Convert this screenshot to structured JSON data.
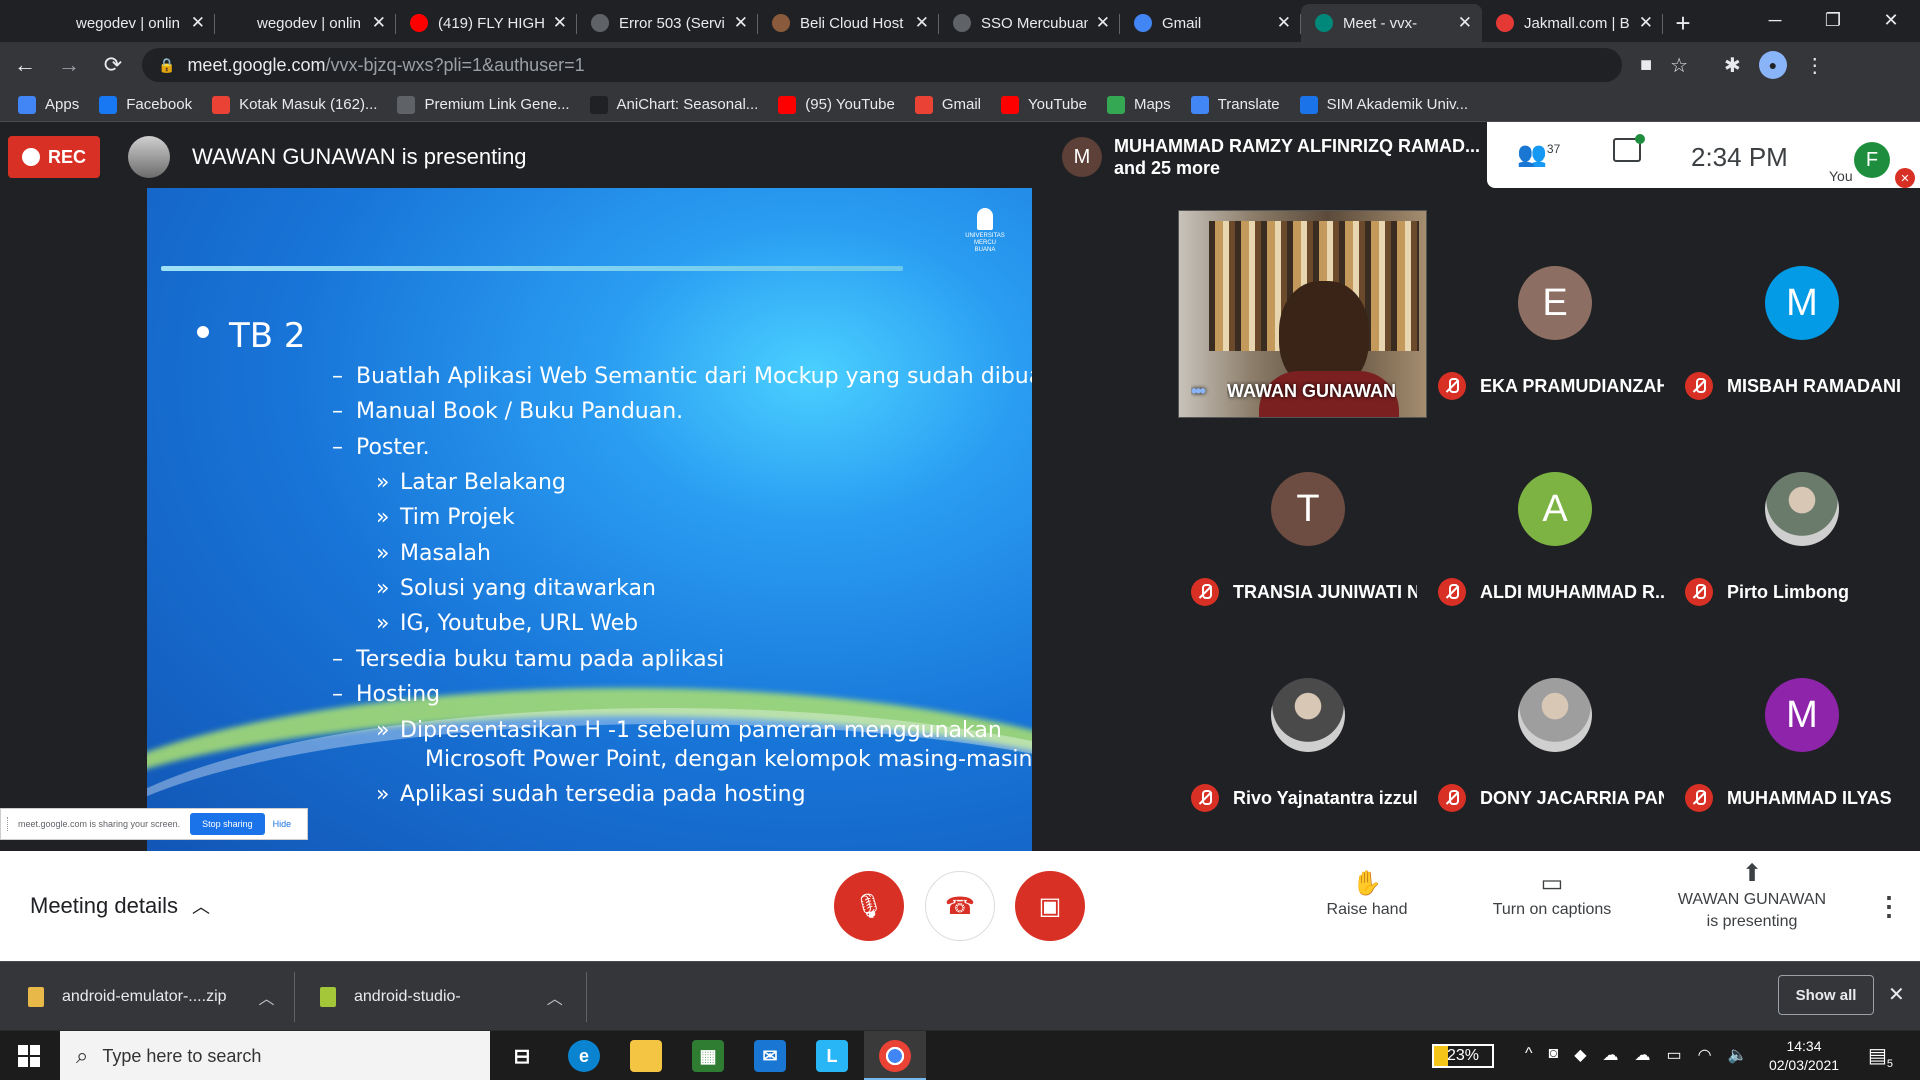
{
  "browser": {
    "tabs": [
      {
        "title": "wegodev | onlin",
        "color": "#202124",
        "icon": "wegodev-icon"
      },
      {
        "title": "wegodev | onlin",
        "color": "#202124",
        "icon": "wegodev-icon"
      },
      {
        "title": "(419) FLY HIGH",
        "color": "#ff0000",
        "icon": "youtube-icon"
      },
      {
        "title": "Error 503 (Servi",
        "color": "#5f6368",
        "icon": "globe-icon"
      },
      {
        "title": "Beli Cloud Host",
        "color": "#8a5a3c",
        "icon": "cloud-host-icon"
      },
      {
        "title": "SSO Mercubuan",
        "color": "#5f6368",
        "icon": "globe-icon"
      },
      {
        "title": "Gmail",
        "color": "#4285f4",
        "icon": "google-icon"
      },
      {
        "title": "Meet - vvx-",
        "color": "#00897b",
        "icon": "meet-icon",
        "active": true
      },
      {
        "title": "Jakmall.com | B",
        "color": "#e53935",
        "icon": "jakmall-icon"
      }
    ],
    "new_tab": "+",
    "url_host": "meet.google.com",
    "url_path": "/vvx-bjzq-wxs?pli=1&authuser=1",
    "bookmarks": [
      {
        "label": "Apps",
        "color": "#4285f4"
      },
      {
        "label": "Facebook",
        "color": "#1877f2"
      },
      {
        "label": "Kotak Masuk (162)...",
        "color": "#ea4335"
      },
      {
        "label": "Premium Link Gene...",
        "color": "#5f6368"
      },
      {
        "label": "AniChart: Seasonal...",
        "color": "#202124"
      },
      {
        "label": "(95) YouTube",
        "color": "#ff0000"
      },
      {
        "label": "Gmail",
        "color": "#ea4335"
      },
      {
        "label": "YouTube",
        "color": "#ff0000"
      },
      {
        "label": "Maps",
        "color": "#34a853"
      },
      {
        "label": "Translate",
        "color": "#4285f4"
      },
      {
        "label": "SIM Akademik Univ...",
        "color": "#1a73e8"
      }
    ]
  },
  "meet": {
    "rec_label": "REC",
    "presenter_title": "WAWAN GUNAWAN is presenting",
    "speaker_initial": "M",
    "speaker_name": "MUHAMMAD RAMZY ALFINRIZQ RAMAD...",
    "speaker_more": "and 25 more",
    "people_count": "37",
    "time": "2:34 PM",
    "you_label": "You",
    "you_initial": "F"
  },
  "slide": {
    "logo_text": "UNIVERSITAS MERCU BUANA",
    "heading": "TB 2",
    "lines": [
      {
        "text": "Buatlah Aplikasi Web Semantic dari Mockup yang sudah dibuat",
        "marker": "–"
      },
      {
        "text": "Manual Book / Buku Panduan.",
        "marker": "–"
      },
      {
        "text": "Poster.",
        "marker": "–"
      },
      {
        "text": "Latar Belakang",
        "marker": "»"
      },
      {
        "text": "Tim Projek",
        "marker": "»"
      },
      {
        "text": "Masalah",
        "marker": "»"
      },
      {
        "text": "Solusi yang ditawarkan",
        "marker": "»"
      },
      {
        "text": "IG, Youtube, URL Web",
        "marker": "»"
      },
      {
        "text": "Tersedia buku tamu pada aplikasi",
        "marker": "–"
      },
      {
        "text": "Hosting",
        "marker": "–"
      },
      {
        "text": "Dipresentasikan H -1 sebelum pameran menggunakan",
        "marker": "»"
      },
      {
        "text": "Microsoft Power Point, dengan kelompok masing-masing.",
        "marker": ""
      },
      {
        "text": "Aplikasi sudah tersedia pada hosting",
        "marker": "»"
      }
    ]
  },
  "sharebar": {
    "message": "meet.google.com is sharing your screen.",
    "stop": "Stop sharing",
    "hide": "Hide"
  },
  "participants": [
    {
      "name": "WAWAN GUNAWAN",
      "initial": "",
      "color": "",
      "video": true
    },
    {
      "name": "EKA PRAMUDIANZAH",
      "initial": "E",
      "color": "#8d6e63"
    },
    {
      "name": "MISBAH RAMADANI",
      "initial": "M",
      "color": "#039be5"
    },
    {
      "name": "TRANSIA JUNIWATI N...",
      "initial": "T",
      "color": "#6d4c41"
    },
    {
      "name": "ALDI MUHAMMAD R...",
      "initial": "A",
      "color": "#7cb342"
    },
    {
      "name": "Pirto Limbong",
      "initial": "",
      "color": "#6b7b6b"
    },
    {
      "name": "Rivo Yajnatantra izzul...",
      "initial": "",
      "color": "#4a4a4a"
    },
    {
      "name": "DONY JACARRIA PAN...",
      "initial": "",
      "color": "#9e9e9e"
    },
    {
      "name": "MUHAMMAD ILYAS",
      "initial": "M",
      "color": "#8e24aa"
    }
  ],
  "bottom": {
    "meeting_details": "Meeting details",
    "raise_hand": "Raise hand",
    "captions": "Turn on captions",
    "presenting_line1": "WAWAN GUNAWAN",
    "presenting_line2": "is presenting"
  },
  "downloads": [
    {
      "name": "android-emulator-....zip",
      "type": "zip"
    },
    {
      "name": "android-studio-",
      "type": "apk"
    }
  ],
  "downloads_show_all": "Show all",
  "taskbar": {
    "search_placeholder": "Type here to search",
    "battery": "23%",
    "time": "14:34",
    "date": "02/03/2021",
    "notifications": "5"
  }
}
